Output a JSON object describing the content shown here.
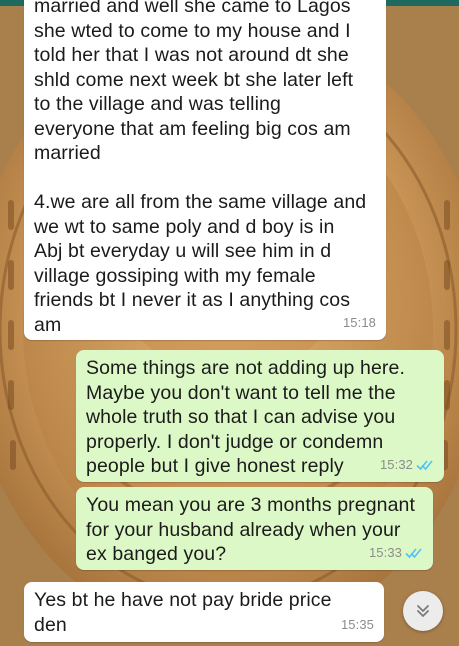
{
  "messages": [
    {
      "direction": "incoming",
      "text": "married and well she came to Lagos\nshe wted to come to my house and I\ntold her that I was not around dt she\nshld come next week bt she later left\nto the village and was telling\neveryone that am feeling big cos am\nmarried\n\n4.we are all from the same village and\nwe wt to same poly and d boy is in\nAbj bt everyday u will see him in d\nvillage gossiping with my female\nfriends bt I never it as I anything cos\nam",
      "time": "15:18"
    },
    {
      "direction": "outgoing",
      "text": "Some things are not adding up here.\nMaybe you don't want to tell me the\nwhole truth so that I can advise you\nproperly. I don't judge or condemn\npeople but I give honest reply",
      "time": "15:32",
      "status": "read"
    },
    {
      "direction": "outgoing",
      "text": "You mean you are 3 months pregnant\nfor your husband already when your\nex banged you?",
      "time": "15:33",
      "status": "read"
    },
    {
      "direction": "incoming",
      "text": "Yes bt he have not pay bride price\nden",
      "time": "15:35"
    }
  ],
  "colors": {
    "outgoing_bubble": "#dcf8c6",
    "incoming_bubble": "#ffffff",
    "read_ticks": "#4fc3f7",
    "header": "#1e6a5e"
  },
  "icons": {
    "scroll_down": "double-chevron-down-icon",
    "read_receipt": "double-check-icon"
  }
}
